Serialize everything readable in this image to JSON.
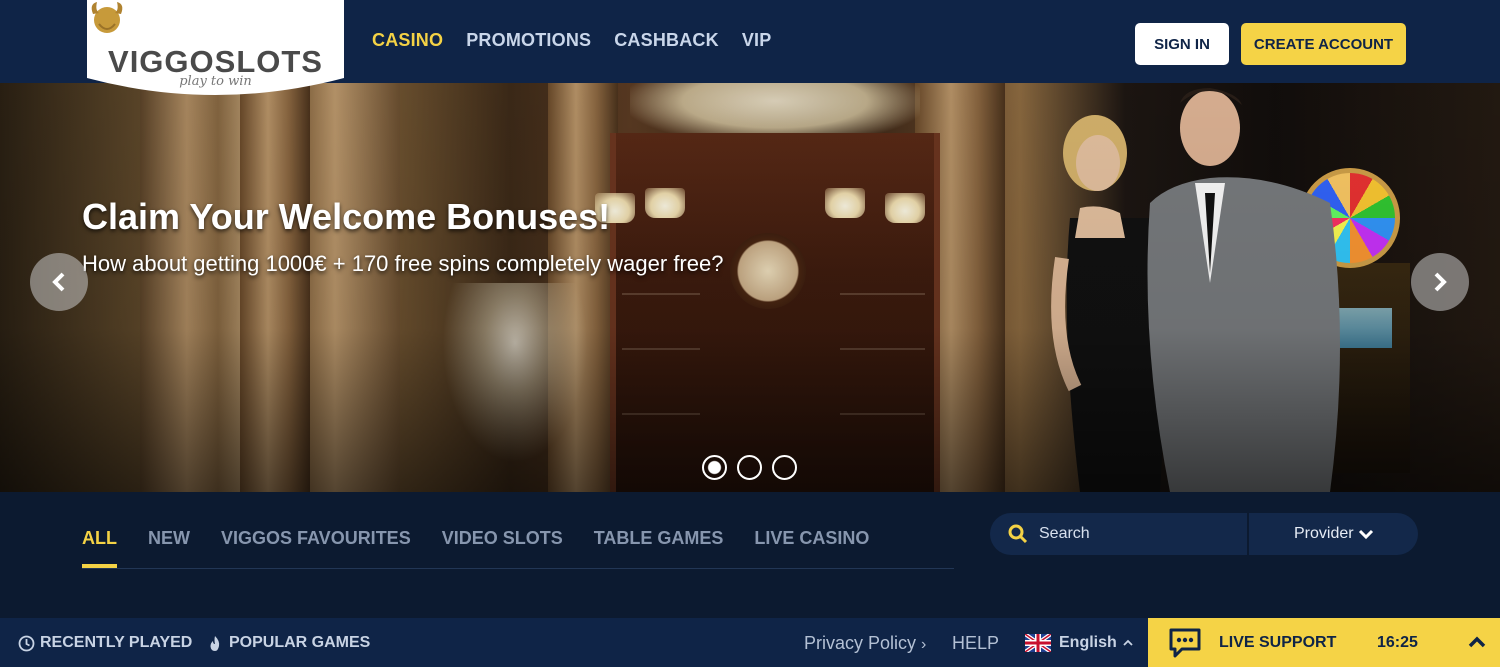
{
  "logo": {
    "name": "VIGGOSLOTS",
    "tagline": "play to win"
  },
  "nav": {
    "items": [
      {
        "label": "CASINO",
        "active": true
      },
      {
        "label": "PROMOTIONS"
      },
      {
        "label": "CASHBACK"
      },
      {
        "label": "VIP"
      }
    ]
  },
  "header": {
    "signin_label": "SIGN IN",
    "create_account_label": "CREATE ACCOUNT"
  },
  "hero": {
    "title": "Claim Your Welcome Bonuses!",
    "subtitle": "How about getting 1000€ + 170 free spins completely wager free?",
    "slide_count": 3,
    "active_slide": 1
  },
  "game_tabs": {
    "items": [
      "ALL",
      "NEW",
      "VIGGOS FAVOURITES",
      "VIDEO SLOTS",
      "TABLE GAMES",
      "LIVE CASINO"
    ],
    "active": "ALL"
  },
  "search": {
    "placeholder": "Search",
    "provider_label": "Provider"
  },
  "footer": {
    "recently_played": "RECENTLY PLAYED",
    "popular_games": "POPULAR GAMES",
    "privacy_policy": "Privacy Policy",
    "help": "HELP",
    "language": "English",
    "live_support": "LIVE SUPPORT",
    "time": "16:25"
  },
  "colors": {
    "accent": "#f5d346",
    "header_bg": "#0f2447",
    "page_bg": "#0c1a30"
  }
}
